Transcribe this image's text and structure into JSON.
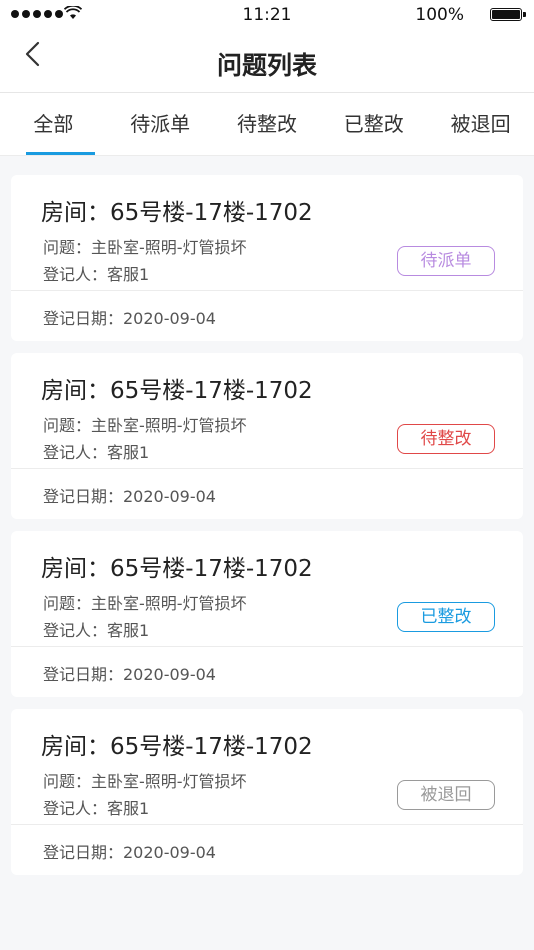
{
  "status_bar": {
    "time": "11:21",
    "battery": "100%"
  },
  "header": {
    "title": "问题列表",
    "back_icon": "chevron-left-icon"
  },
  "tabs": [
    {
      "label": "全部",
      "active": true
    },
    {
      "label": "待派单",
      "active": false
    },
    {
      "label": "待整改",
      "active": false
    },
    {
      "label": "已整改",
      "active": false
    },
    {
      "label": "被退回",
      "active": false
    }
  ],
  "colors": {
    "accent": "#1a9be0",
    "pending_dispatch": "#b88be0",
    "pending_fix": "#e04848",
    "fixed": "#1a9be0",
    "returned": "#9a9a9a"
  },
  "issues": [
    {
      "room": "房间：65号楼-17楼-1702",
      "problem": "问题：主卧室-照明-灯管损坏",
      "registrant": "登记人：客服1",
      "date": "登记日期：2020-09-04",
      "status": "待派单",
      "status_color": "#b88be0"
    },
    {
      "room": "房间：65号楼-17楼-1702",
      "problem": "问题：主卧室-照明-灯管损坏",
      "registrant": "登记人：客服1",
      "date": "登记日期：2020-09-04",
      "status": "待整改",
      "status_color": "#e04848"
    },
    {
      "room": "房间：65号楼-17楼-1702",
      "problem": "问题：主卧室-照明-灯管损坏",
      "registrant": "登记人：客服1",
      "date": "登记日期：2020-09-04",
      "status": "已整改",
      "status_color": "#1a9be0"
    },
    {
      "room": "房间：65号楼-17楼-1702",
      "problem": "问题：主卧室-照明-灯管损坏",
      "registrant": "登记人：客服1",
      "date": "登记日期：2020-09-04",
      "status": "被退回",
      "status_color": "#9a9a9a"
    }
  ]
}
